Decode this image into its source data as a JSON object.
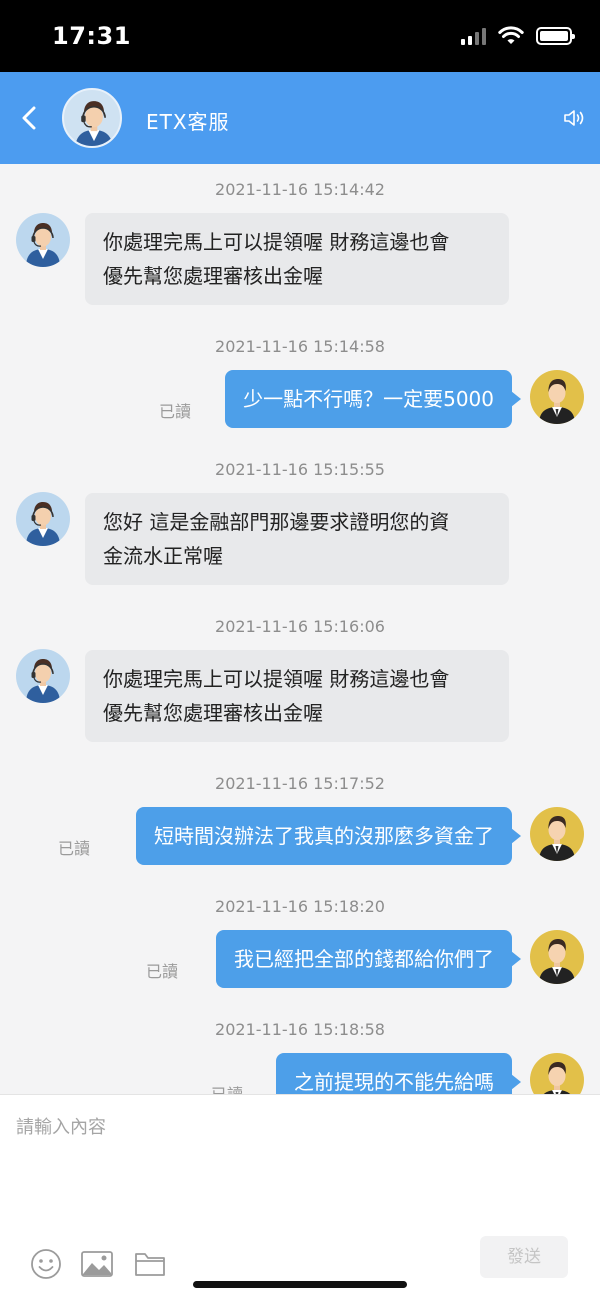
{
  "status_bar": {
    "time": "17:31"
  },
  "header": {
    "title": "ETX客服"
  },
  "messages": [
    {
      "timestamp": "2021-11-16 15:14:42",
      "sender": "agent",
      "lines": [
        "你處理完馬上可以提領喔 財務這邊也會",
        "優先幫您處理審核出金喔"
      ]
    },
    {
      "timestamp": "2021-11-16 15:14:58",
      "sender": "user",
      "text": "少一點不行嗎？一定要5000",
      "read": "已讀"
    },
    {
      "timestamp": "2021-11-16 15:15:55",
      "sender": "agent",
      "lines": [
        "您好 這是金融部門那邊要求證明您的資",
        "金流水正常喔"
      ]
    },
    {
      "timestamp": "2021-11-16 15:16:06",
      "sender": "agent",
      "lines": [
        "你處理完馬上可以提領喔 財務這邊也會",
        "優先幫您處理審核出金喔"
      ]
    },
    {
      "timestamp": "2021-11-16 15:17:52",
      "sender": "user",
      "text": "短時間沒辦法了我真的沒那麼多資金了",
      "read": "已讀"
    },
    {
      "timestamp": "2021-11-16 15:18:20",
      "sender": "user",
      "text": "我已經把全部的錢都給你們了",
      "read": "已讀"
    },
    {
      "timestamp": "2021-11-16 15:18:58",
      "sender": "user",
      "text": "之前提現的不能先給嗎",
      "read": "已讀"
    }
  ],
  "input": {
    "placeholder": "請輸入內容",
    "send_label": "發送"
  },
  "colors": {
    "header": "#4c9cf0",
    "user_bubble": "#4d9fe9",
    "agent_bubble": "#e8e9eb"
  },
  "icons": [
    "back-icon",
    "speaker-icon",
    "emoji-icon",
    "image-icon",
    "folder-icon"
  ]
}
